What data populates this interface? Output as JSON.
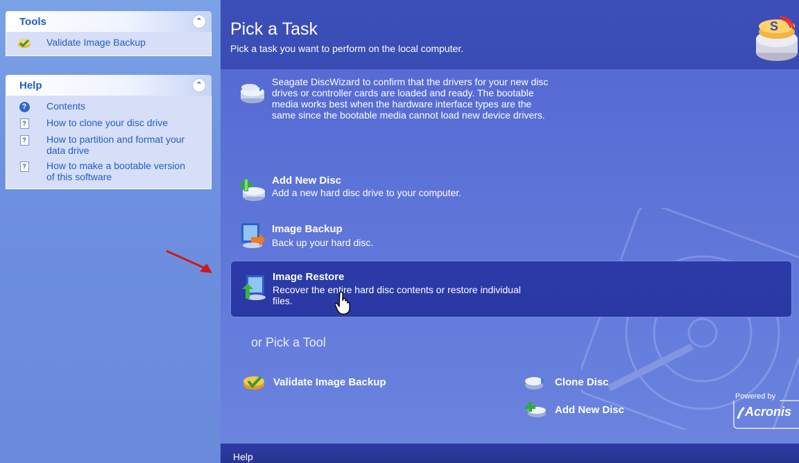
{
  "sidebar": {
    "tools": {
      "title": "Tools",
      "items": [
        {
          "label": "Validate Image Backup",
          "icon": "validate-icon"
        }
      ]
    },
    "help": {
      "title": "Help",
      "items": [
        {
          "label": "Contents",
          "icon": "help-icon"
        },
        {
          "label": "How to clone your disc drive",
          "icon": "help-doc-icon"
        },
        {
          "label": "How to partition and format your data drive",
          "icon": "help-doc-icon"
        },
        {
          "label": "How to make a bootable version of this software",
          "icon": "help-doc-icon"
        }
      ]
    }
  },
  "header": {
    "title": "Pick a Task",
    "subtitle": "Pick a task you want to perform on the local computer."
  },
  "tasks": {
    "partial_desc": "Seagate DiscWizard to confirm that the drivers for your new disc drives or controller cards are loaded and ready. The bootable media works best when the hardware interface types are the same since the bootable media cannot load new device drivers.",
    "add_new_disc": {
      "title": "Add New Disc",
      "desc": "Add a new hard disc drive to your computer."
    },
    "image_backup": {
      "title": "Image Backup",
      "desc": "Back up your hard disc."
    },
    "image_restore": {
      "title": "Image Restore",
      "desc": "Recover the entire hard disc contents or restore individual files."
    }
  },
  "tools_section": {
    "heading": "or Pick a Tool",
    "validate": "Validate Image Backup",
    "clone": "Clone Disc",
    "add_disc": "Add New Disc"
  },
  "branding": {
    "powered_by": "Powered by",
    "name": "Acronis"
  },
  "footer": {
    "help": "Help"
  },
  "colors": {
    "header_bg": "#3c4fb8",
    "sidebar_bg": "#7ba2e7",
    "highlight": "#2c3ba9",
    "link": "#215dc6"
  }
}
